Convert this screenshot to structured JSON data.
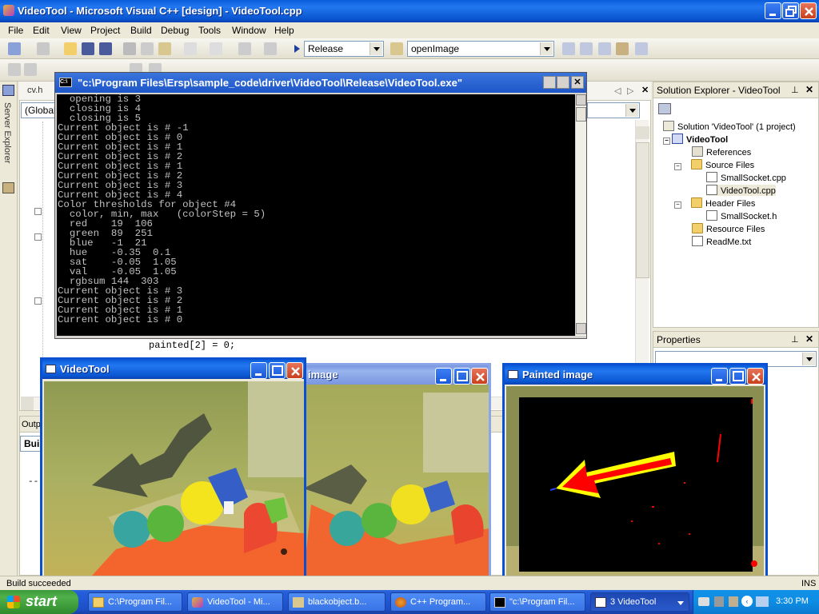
{
  "vs": {
    "title": "VideoTool - Microsoft Visual C++ [design] - VideoTool.cpp",
    "menu": [
      "File",
      "Edit",
      "View",
      "Project",
      "Build",
      "Debug",
      "Tools",
      "Window",
      "Help"
    ],
    "config_value": "Release",
    "function_value": "openImage",
    "editor_tab": "cv.h",
    "scope_value": "(Global",
    "code_line": "painted[2] = 0;",
    "side_label": "Server Explorer",
    "output_tab": "Outp",
    "output_sub": "Build",
    "output_line": "--",
    "status": "Build succeeded",
    "ins": "INS"
  },
  "solution_explorer": {
    "title": "Solution Explorer - VideoTool",
    "items": [
      {
        "label": "Solution 'VideoTool' (1 project)",
        "icon": "solution"
      },
      {
        "label": "VideoTool",
        "icon": "project",
        "bold": true
      },
      {
        "label": "References",
        "icon": "references"
      },
      {
        "label": "Source Files",
        "icon": "folder"
      },
      {
        "label": "SmallSocket.cpp",
        "icon": "file"
      },
      {
        "label": "VideoTool.cpp",
        "icon": "file"
      },
      {
        "label": "Header Files",
        "icon": "folder"
      },
      {
        "label": "SmallSocket.h",
        "icon": "file"
      },
      {
        "label": "Resource Files",
        "icon": "folder"
      },
      {
        "label": "ReadMe.txt",
        "icon": "file"
      }
    ]
  },
  "properties": {
    "title": "Properties"
  },
  "console": {
    "title": "\"c:\\Program Files\\Ersp\\sample_code\\driver\\VideoTool\\Release\\VideoTool.exe\"",
    "lines": [
      "  opening is 3",
      "  closing is 4",
      "  closing is 5",
      "Current object is # -1",
      "Current object is # 0",
      "Current object is # 1",
      "Current object is # 2",
      "Current object is # 1",
      "Current object is # 2",
      "Current object is # 3",
      "Current object is # 4",
      "Color thresholds for object #4",
      "  color, min, max   (colorStep = 5)",
      "  red    19  106",
      "  green  89  251",
      "  blue   -1  21",
      "  hue    -0.35  0.1",
      "  sat    -0.05  1.05",
      "  val    -0.05  1.05",
      "  rgbsum 144  303",
      "Current object is # 3",
      "Current object is # 2",
      "Current object is # 1",
      "Current object is # 0"
    ]
  },
  "windows": {
    "videotool": "VideoTool",
    "middle": "image",
    "painted": "Painted image"
  },
  "taskbar": {
    "start": "start",
    "tasks": [
      "C:\\Program Fil...",
      "VideoTool - Mi...",
      "blackobject.b...",
      "C++ Program...",
      "\"c:\\Program Fil...",
      "3 VideoTool"
    ],
    "clock": "3:30 PM"
  },
  "colors": {
    "xp_blue": "#0a5ddb",
    "taskbar_blue": "#245edb",
    "start_green": "#3c9a3a",
    "console_bg": "#000000",
    "painted_red": "#ff0000"
  }
}
